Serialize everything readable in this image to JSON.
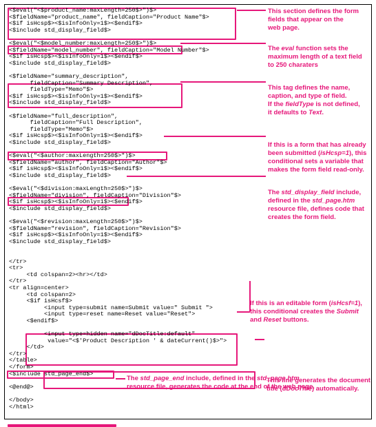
{
  "code": {
    "l1": "<$eval(\"<$product_name:maxLength=250$>\")$>",
    "l2": "<$fieldName=\"product_name\", fieldCaption=\"Product Name\"$>",
    "l3": "<$if isHcsp$><$isInfoOnly=1$><$endif$>",
    "l4": "<$include std_display_field$>",
    "l5": "",
    "l6": "<$eval(\"<$model_number:maxLength=250$>\")$>",
    "l7": "<$fieldName=\"model_number\", fieldCaption=\"Model Number\"$>",
    "l8": "<$if isHcsp$><$isInfoOnly=1$><$endif$>",
    "l9": "<$include std_display_field$>",
    "l10": "",
    "l11": "<$fieldName=\"summary_description\",",
    "l12": "      fieldCaption=\"Summary Description\",",
    "l13": "      fieldType=\"Memo\"$>",
    "l14": "<$if isHcsp$><$isInfoOnly=1$><$endif$>",
    "l15": "<$include std_display_field$>",
    "l16": "",
    "l17": "<$fieldName=\"full_description\",",
    "l18": "      fieldCaption=\"Full Description\",",
    "l19": "      fieldType=\"Memo\"$>",
    "l20": "<$if isHcsp$><$isInfoOnly=1$><$endif$>",
    "l21": "<$include std_display_field$>",
    "l22": "",
    "l23": "<$eval(\"<$author:maxLength=250$>\")$>",
    "l24": "<$fieldName=\"author\", fieldCaption=\"Author\"$>",
    "l25": "<$if isHcsp$><$isInfoOnly=1$><$endif$>",
    "l26": "<$include std_display_field$>",
    "l27": "",
    "l28": "<$eval(\"<$division:maxLength=250$>\")$>",
    "l29": "<$fieldName=\"division\", fieldCaption=\"Division\"$>",
    "l30": "<$if isHcsp$><$isInfoOnly=1$><$endif$>",
    "l31": "<$include std_display_field$>",
    "l32": "",
    "l33": "<$eval(\"<$revision:maxLength=250$>\")$>",
    "l34": "<$fieldName=\"revision\", fieldCaption=\"Revision\"$>",
    "l35": "<$if isHcsp$><$isInfoOnly=1$><$endif$>",
    "l36": "<$include std_display_field$>",
    "l37": "",
    "l38": "",
    "l39": "</tr>",
    "l40": "<tr>",
    "l41": "     <td colspan=2><hr></td>",
    "l42": "</tr>",
    "l43": "<tr align=center>",
    "l44": "     <td colspan=2>",
    "l45": "     <$if isHcsf$>",
    "l46": "          <input type=submit name=Submit value=\" Submit \">",
    "l47": "          <input type=reset name=Reset value=\"Reset\">",
    "l48": "     <$endif$>",
    "l49": "",
    "l50": "          <input type=hidden name=\"dDocTitle:default\"",
    "l51": "           value=\"<$'Product Description ' & dateCurrent()$>\">",
    "l52": "     </td>",
    "l53": "</tr>",
    "l54": "</table>",
    "l55": "</form>",
    "l56": "<$include std_page_end$>",
    "l57": "",
    "l58": "<@end@>",
    "l59": "",
    "l60": "</body>",
    "l61": "</html>"
  },
  "ann": {
    "a1a": "This section defines the form",
    "a1b": "fields that appear on the",
    "a1c": "web page.",
    "a2a": "The ",
    "a2b": "eval",
    "a2c": " function sets the",
    "a2d": "maximum length of a text field",
    "a2e": "to 250 charaters",
    "a3a": "This tag defines the name,",
    "a3b": "caption, and type of field.",
    "a3c": "If the ",
    "a3d": "fieldType",
    "a3e": " is not defined,",
    "a3f": "it defaults to ",
    "a3g": "Text",
    "a3h": ".",
    "a4a": "If this is a form that has already",
    "a4b": "been submitted (",
    "a4c": "isHcsp=1",
    "a4d": "), this",
    "a4e": "conditional sets a variable that",
    "a4f": "makes the form field read-only.",
    "a5a": "The ",
    "a5b": "std_display_field",
    "a5c": " include,",
    "a5d": "defined in the ",
    "a5e": "std_page.htm",
    "a5f": "resource file, defines code that",
    "a5g": "creates the form field.",
    "a6a": "If this is an editable form (",
    "a6b": "isHcsf=1",
    "a6c": "),",
    "a6d": "this conditional creates the ",
    "a6e": "Submit",
    "a6f": "and ",
    "a6g": "Reset",
    "a6h": " buttons.",
    "a7a": "This line generates the document",
    "a7b": "title (",
    "a7c": "dDocTitle",
    "a7d": ") automatically.",
    "a8a": "The ",
    "a8b": "std_page_end",
    "a8c": " include, defined in the ",
    "a8d": "std_page.htm",
    "a8e": "resource file, generates the code at the end of the web page."
  }
}
